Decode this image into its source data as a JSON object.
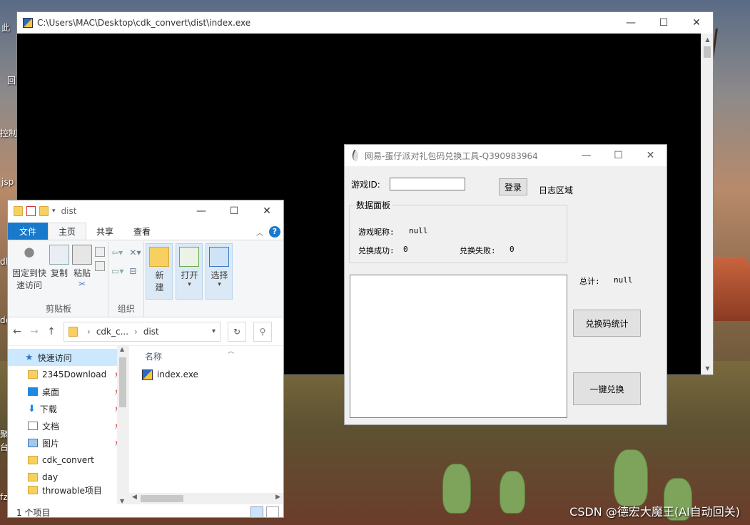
{
  "desktop": {
    "labels": [
      "此",
      "回",
      "控制",
      "jsp",
      "dk",
      "de",
      "聚",
      "台",
      "fz"
    ],
    "watermark": "CSDN @德宏大魔王(AI自动回关)"
  },
  "cmd_window": {
    "title": "C:\\Users\\MAC\\Desktop\\cdk_convert\\dist\\index.exe",
    "minimize": "—",
    "maximize": "☐",
    "close": "✕"
  },
  "explorer": {
    "title": "dist",
    "minimize": "—",
    "maximize": "☐",
    "close": "✕",
    "tabs": {
      "file": "文件",
      "home": "主页",
      "share": "共享",
      "view": "查看"
    },
    "ribbon": {
      "pin_line1": "固定到快",
      "pin_line2": "速访问",
      "copy": "复制",
      "paste": "粘贴",
      "clipboard_group": "剪贴板",
      "organize_group": "组织",
      "new_line1": "新",
      "new_line2": "建",
      "open": "打开",
      "select": "选择"
    },
    "address": {
      "crumb1": "cdk_c...",
      "crumb2": "dist"
    },
    "nav_items": [
      {
        "label": "快速访问"
      },
      {
        "label": "2345Download"
      },
      {
        "label": "桌面"
      },
      {
        "label": "下载"
      },
      {
        "label": "文档"
      },
      {
        "label": "图片"
      },
      {
        "label": "cdk_convert"
      },
      {
        "label": "day"
      },
      {
        "label": "throwable项目"
      }
    ],
    "column_name": "名称",
    "files": [
      {
        "name": "index.exe"
      }
    ],
    "status": "1 个项目"
  },
  "tool": {
    "title": "网易-蛋仔派对礼包码兑换工具-Q390983964",
    "minimize": "—",
    "maximize": "☐",
    "close": "✕",
    "game_id_label": "游戏ID:",
    "game_id_value": "",
    "login_button": "登录",
    "log_area_label": "日志区域",
    "data_panel_label": "数据面板",
    "nickname_label": "游戏昵称:",
    "nickname_value": "null",
    "success_label": "兑换成功:",
    "success_value": "0",
    "fail_label": "兑换失败:",
    "fail_value": "0",
    "total_label": "总计:",
    "total_value": "null",
    "stats_button": "兑换码统计",
    "redeem_button": "一键兑换"
  }
}
